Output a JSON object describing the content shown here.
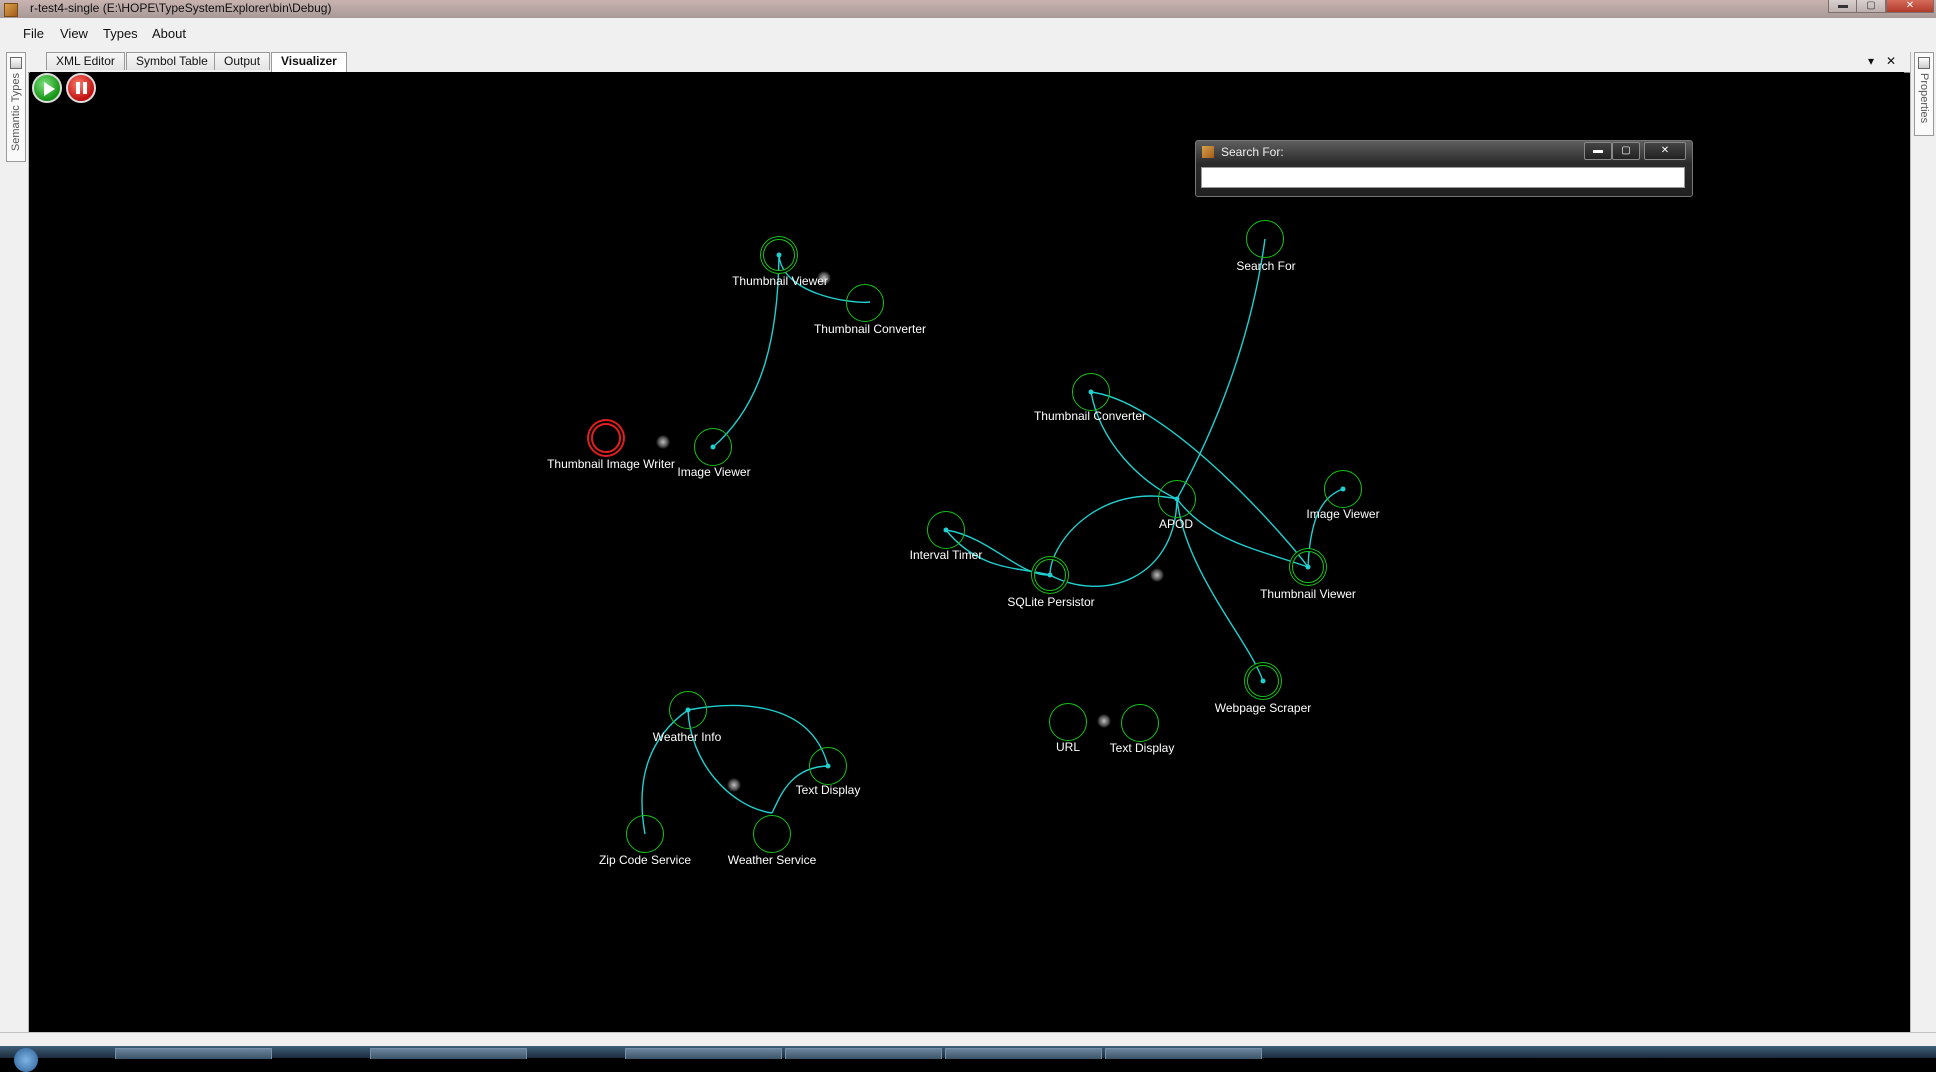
{
  "window": {
    "title": "r-test4-single (E:\\HOPE\\TypeSystemExplorer\\bin\\Debug)",
    "controls": [
      "minimize",
      "maximize",
      "close"
    ]
  },
  "menu": {
    "items": [
      {
        "label": "File"
      },
      {
        "label": "View"
      },
      {
        "label": "Types"
      },
      {
        "label": "About"
      }
    ]
  },
  "tabs": [
    {
      "label": "XML Editor",
      "active": false
    },
    {
      "label": "Symbol Table",
      "active": false
    },
    {
      "label": "Output",
      "active": false
    },
    {
      "label": "Visualizer",
      "active": true
    }
  ],
  "tab_controls": {
    "dropdown": "▾",
    "close": "✕"
  },
  "left_rail": {
    "label": "Semantic Types"
  },
  "right_rail": {
    "label": "Properties"
  },
  "toolbar": {
    "play_icon": "play-icon",
    "pause_icon": "pause-icon"
  },
  "search_window": {
    "title": "Search For:",
    "value": "",
    "controls": {
      "minimize": "▬",
      "maximize": "▢",
      "close": "✕"
    }
  },
  "visualizer": {
    "colors": {
      "background": "#000000",
      "node": "#18c018",
      "link": "#20d0d0",
      "label": "#ffffff",
      "error_node": "#e02020"
    },
    "groups": [
      {
        "name": "thumbnail-group",
        "nodes": [
          "Thumbnail Viewer",
          "Thumbnail Converter"
        ]
      },
      {
        "name": "image-group",
        "nodes": [
          "Thumbnail Image Writer",
          "Image Viewer"
        ]
      },
      {
        "name": "weather-group",
        "nodes": [
          "Weather Info",
          "Text Display",
          "Zip Code Service",
          "Weather Service"
        ]
      },
      {
        "name": "apod-group",
        "nodes": [
          "Thumbnail Converter",
          "APOD",
          "Image Viewer",
          "Interval Timer",
          "SQLite Persistor",
          "Thumbnail Viewer",
          "Webpage Scraper"
        ]
      },
      {
        "name": "url-group",
        "nodes": [
          "URL",
          "Text Display"
        ]
      }
    ],
    "labels": {
      "n1": "Thumbnail Viewer",
      "n2": "Thumbnail Converter",
      "n3": "Thumbnail Image Writer",
      "n4": "Image Viewer",
      "n5": "Search For",
      "n6": "Thumbnail Converter",
      "n7": "APOD",
      "n8": "Image Viewer",
      "n9": "Interval Timer",
      "n10": "SQLite Persistor",
      "n11": "Thumbnail Viewer",
      "n12": "Webpage Scraper",
      "n13": "Weather Info",
      "n14": "Text Display",
      "n15": "Zip Code Service",
      "n16": "Weather Service",
      "n17": "URL",
      "n18": "Text Display"
    }
  }
}
